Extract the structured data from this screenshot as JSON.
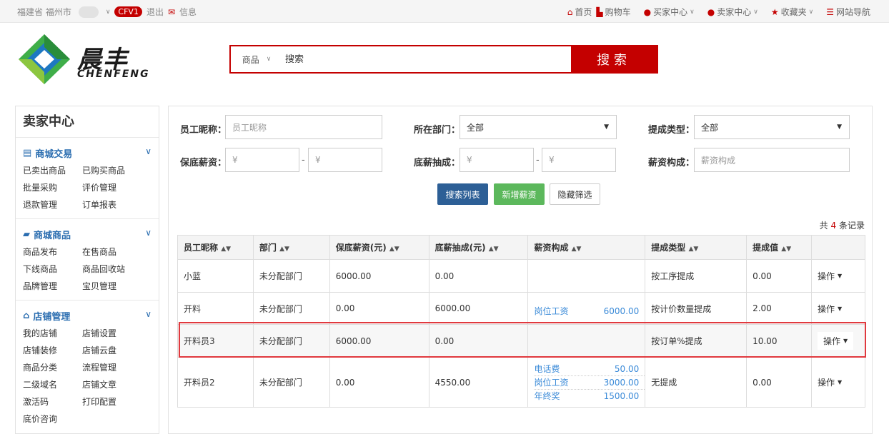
{
  "topbar": {
    "location": "福建省 福州市",
    "badge": "CFV1",
    "logout": "退出",
    "message": "信息",
    "home": "首页",
    "cart": "购物车",
    "buyer_center": "买家中心",
    "seller_center": "卖家中心",
    "favorites": "收藏夹",
    "site_nav": "网站导航"
  },
  "logo": {
    "cn": "晨丰",
    "en": "CHENFENG"
  },
  "search": {
    "category": "商品",
    "placeholder": "搜索",
    "button": "搜索"
  },
  "sidebar": {
    "title": "卖家中心",
    "groups": [
      {
        "title": "商城交易",
        "links": [
          "已卖出商品",
          "已购买商品",
          "批量采购",
          "评价管理",
          "退款管理",
          "订单报表"
        ]
      },
      {
        "title": "商城商品",
        "links": [
          "商品发布",
          "在售商品",
          "下线商品",
          "商品回收站",
          "品牌管理",
          "宝贝管理"
        ]
      },
      {
        "title": "店铺管理",
        "links": [
          "我的店铺",
          "店铺设置",
          "店铺装修",
          "店铺云盘",
          "商品分类",
          "流程管理",
          "二级域名",
          "店铺文章",
          "激活码",
          "打印配置",
          "底价咨询"
        ]
      }
    ]
  },
  "filters": {
    "nickname_label": "员工昵称：",
    "nickname_placeholder": "员工昵称",
    "dept_label": "所在部门：",
    "dept_value": "全部",
    "commission_type_label": "提成类型：",
    "commission_type_value": "全部",
    "base_salary_label": "保底薪资：",
    "base_commission_label": "底薪抽成：",
    "currency": "¥",
    "range_sep": "-",
    "composition_label": "薪资构成：",
    "composition_placeholder": "薪资构成"
  },
  "buttons": {
    "search_list": "搜索列表",
    "add_salary": "新增薪资",
    "hide_filter": "隐藏筛选"
  },
  "record_count": {
    "prefix": "共",
    "count": "4",
    "suffix": "条记录"
  },
  "table": {
    "headers": [
      "员工昵称",
      "部门",
      "保底薪资(元)",
      "底薪抽成(元)",
      "薪资构成",
      "提成类型",
      "提成值",
      ""
    ],
    "op_label": "操作",
    "rows": [
      {
        "name": "小蓝",
        "dept": "未分配部门",
        "base": "6000.00",
        "commission": "0.00",
        "composition": [],
        "type": "按工序提成",
        "value": "0.00"
      },
      {
        "name": "开料",
        "dept": "未分配部门",
        "base": "0.00",
        "commission": "6000.00",
        "composition": [
          {
            "item": "岗位工资",
            "amount": "6000.00"
          }
        ],
        "type": "按计价数量提成",
        "value": "2.00"
      },
      {
        "name": "开料员3",
        "dept": "未分配部门",
        "base": "6000.00",
        "commission": "0.00",
        "composition": [],
        "type": "按订单%提成",
        "value": "10.00"
      },
      {
        "name": "开料员2",
        "dept": "未分配部门",
        "base": "0.00",
        "commission": "4550.00",
        "composition": [
          {
            "item": "电话费",
            "amount": "50.00"
          },
          {
            "item": "岗位工资",
            "amount": "3000.00"
          },
          {
            "item": "年终奖",
            "amount": "1500.00"
          }
        ],
        "type": "无提成",
        "value": "0.00"
      }
    ]
  }
}
